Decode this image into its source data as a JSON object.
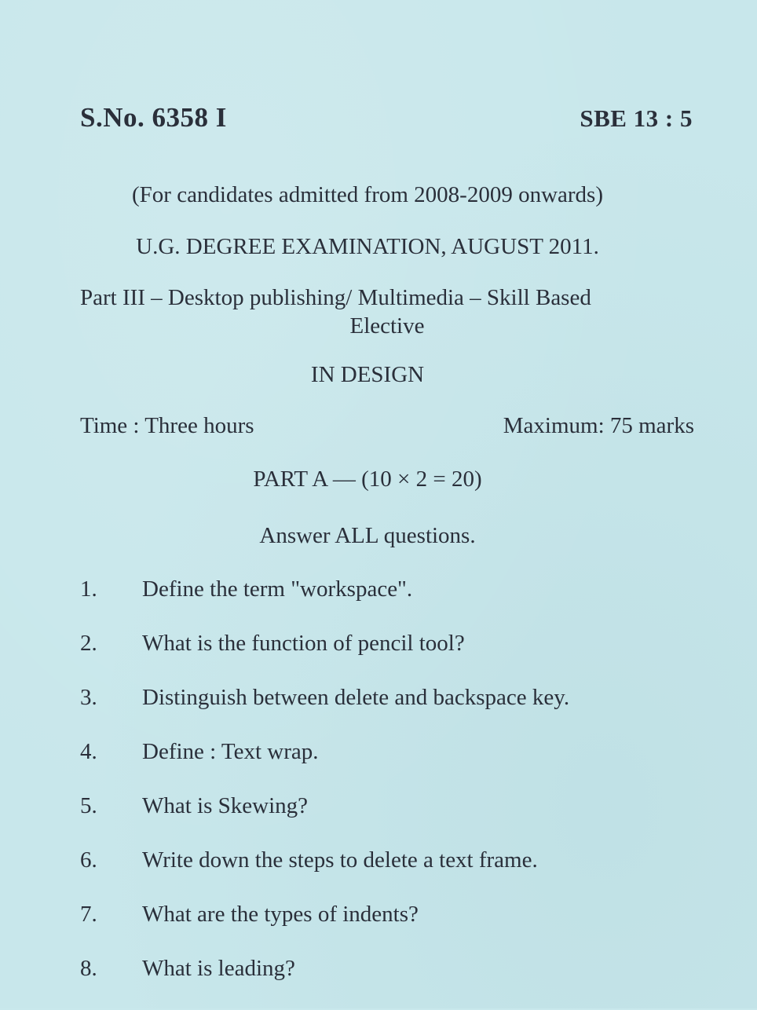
{
  "header": {
    "serial_number": "S.No. 6358 I",
    "paper_code": "SBE 13 : 5"
  },
  "eligibility": "(For candidates admitted from 2008-2009 onwards)",
  "exam_title": "U.G. DEGREE EXAMINATION, AUGUST 2011.",
  "paper": {
    "line1_left": "Part III – Desktop publishing/ Multimedia – Skill Based",
    "line2": "Elective"
  },
  "subject": "IN DESIGN",
  "time": "Time : Three hours",
  "max_marks": "Maximum: 75 marks",
  "part_heading": "PART A — (10 × 2 = 20)",
  "instruction": "Answer ALL questions.",
  "questions": [
    {
      "number": "1.",
      "text": "Define the term \"workspace\"."
    },
    {
      "number": "2.",
      "text": "What is the function of pencil tool?"
    },
    {
      "number": "3.",
      "text": "Distinguish between delete and backspace key."
    },
    {
      "number": "4.",
      "text": "Define : Text wrap."
    },
    {
      "number": "5.",
      "text": "What is Skewing?"
    },
    {
      "number": "6.",
      "text": "Write down the steps to delete a text frame."
    },
    {
      "number": "7.",
      "text": "What are the types of indents?"
    },
    {
      "number": "8.",
      "text": "What is leading?"
    }
  ]
}
